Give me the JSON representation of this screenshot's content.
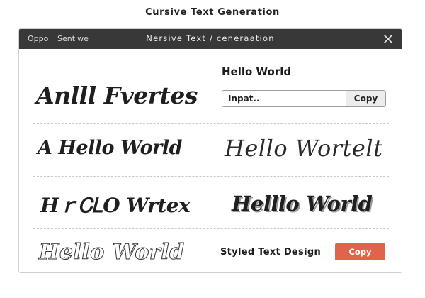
{
  "page": {
    "heading": "Cursive Text Generation"
  },
  "titlebar": {
    "menu": [
      "Oppo",
      "Sentiwe"
    ],
    "title": "Nersive Text / ceneraation",
    "close_icon": "close-icon",
    "background_color": "#383838"
  },
  "samples": {
    "row1_left": "Anlll Fvertes",
    "row2_left": "A Hello World",
    "row2_right": "Hello Wortelt",
    "row3_left": "HｒᏟᏞO Wrtex",
    "row3_right": "Helllo World",
    "row4_left": "Hello World"
  },
  "generator": {
    "heading": "Hello World",
    "input_placeholder": "Inpat..",
    "input_value": "",
    "copy_label": "Copy"
  },
  "footer": {
    "label": "Styled Text Design",
    "copy_label": "Copy",
    "accent_color": "#e0644c"
  }
}
